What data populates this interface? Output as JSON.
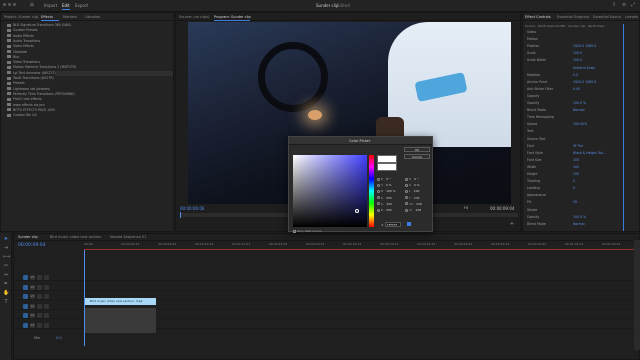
{
  "app": {
    "home_icon": "home-icon",
    "nav": [
      "Import",
      "Edit",
      "Export"
    ],
    "active_nav": "Edit",
    "title": "Sunder clip",
    "subtitle": "Edited"
  },
  "project_panel": {
    "tabs": [
      "Project: Sunder clip",
      "Effects",
      "Markers",
      "Libraries"
    ],
    "items": [
      {
        "label": "NLR Signature Transitions 360 (NAS)"
      },
      {
        "label": "Custom Presets"
      },
      {
        "label": "Audio Effects"
      },
      {
        "label": "Audio Transitions"
      },
      {
        "label": "Video Effects"
      },
      {
        "label": "Obsolete"
      },
      {
        "label": "Blur"
      },
      {
        "label": "Video Transitions"
      },
      {
        "label": "Motion Machine Transitions 2 (MMT2TR)"
      },
      {
        "label": "Lyt Text Animator (AELT2T)"
      },
      {
        "label": "TwoD Transitions (AG2TR)"
      },
      {
        "label": "Presets"
      },
      {
        "label": "Lightroom lab (presets)"
      },
      {
        "label": "Perfectly Time Transitions (PRTSUMNK)"
      },
      {
        "label": "ProVC text effects"
      },
      {
        "label": "www effects via pro"
      },
      {
        "label": "BITTS EFFECTS PACK 1000"
      },
      {
        "label": "Custom Bin LD"
      }
    ]
  },
  "program_monitor": {
    "tabs": [
      "Source: (no clips)",
      "Program: Sunder clip"
    ],
    "timecode_left": "00:00:06:06",
    "fit_label": "Fit",
    "timecode_right": "00:00:09:04"
  },
  "effect_controls": {
    "tabs": [
      "Effect Controls",
      "Essential Graphics",
      "Essential Sound",
      "Lumetri"
    ],
    "source_label": "Source · Nerfz Kaan Nrufflx · Sunder clip · Nerfz Kaan",
    "rows": [
      {
        "label": "Video",
        "value": ""
      },
      {
        "label": "Motion",
        "value": ""
      },
      {
        "label": "Position",
        "value": "1920.0   1080.0"
      },
      {
        "label": "Scale",
        "value": "100.0"
      },
      {
        "label": "Scale Width",
        "value": "100.0"
      },
      {
        "label": "",
        "value": "Uniform Scale"
      },
      {
        "label": "Rotation",
        "value": "0.0"
      },
      {
        "label": "Anchor Point",
        "value": "1920.0   1080.0"
      },
      {
        "label": "Anti-flicker Filter",
        "value": "0.00"
      },
      {
        "label": "Opacity",
        "value": ""
      },
      {
        "label": "Opacity",
        "value": "100.0 %"
      },
      {
        "label": "Blend Mode",
        "value": "Normal"
      },
      {
        "label": "Time Remapping",
        "value": ""
      },
      {
        "label": "Speed",
        "value": "100.00%"
      },
      {
        "label": "Text",
        "value": ""
      },
      {
        "label": "Source Text",
        "value": ""
      },
      {
        "label": "Font",
        "value": "SF Pro"
      },
      {
        "label": "Font Style",
        "value": "Black & Height Gol..."
      },
      {
        "label": "Font Size",
        "value": "100"
      },
      {
        "label": "Width",
        "value": "100"
      },
      {
        "label": "Height",
        "value": "100"
      },
      {
        "label": "Tracking",
        "value": "0"
      },
      {
        "label": "Leading",
        "value": "0"
      },
      {
        "label": "Appearance",
        "value": ""
      },
      {
        "label": "Fill",
        "value": "Fill"
      },
      {
        "label": "Stroke",
        "value": ""
      },
      {
        "label": "Opacity",
        "value": "100.0 %"
      },
      {
        "label": "Blend Mode",
        "value": "Normal"
      }
    ]
  },
  "color_picker": {
    "title": "Color Picker",
    "ok_label": "OK",
    "cancel_label": "Cancel",
    "hsb": [
      {
        "key": "H",
        "value": "0 °"
      },
      {
        "key": "S",
        "value": "0 %"
      },
      {
        "key": "B",
        "value": "100 %"
      },
      {
        "key": "R",
        "value": "255"
      },
      {
        "key": "G",
        "value": "255"
      },
      {
        "key": "B",
        "value": "255"
      }
    ],
    "hsl": [
      {
        "key": "H",
        "value": "0 °"
      },
      {
        "key": "S",
        "value": "0 %"
      },
      {
        "key": "L",
        "value": "100"
      },
      {
        "key": "Y",
        "value": "235"
      },
      {
        "key": "Cb",
        "value": "128"
      },
      {
        "key": "Cr",
        "value": "128"
      }
    ],
    "hex_label": "#",
    "hex_value": "FFFFFF",
    "web_only_label": "Only Web Colors",
    "new_color": "#ffffff",
    "current_color": "#ffffff",
    "field_hue": "#4040ff"
  },
  "timeline": {
    "tabs": [
      "Sunder clip",
      "Bird music video new section",
      "Nested Sequence 01"
    ],
    "timecode": "00:00:09:04",
    "ruler": [
      "00:00",
      "00:00:04:23",
      "00:00:09:23",
      "00:00:14:23",
      "00:00:19:23",
      "00:00:24:23",
      "00:00:29:23",
      "00:00:34:23",
      "00:00:39:23",
      "00:00:44:23",
      "00:00:49:23",
      "00:00:54:23",
      "00:00:59:22",
      "00:01:04:22",
      "00:01:09:22"
    ],
    "video_tracks": [
      "V3",
      "V2",
      "V1"
    ],
    "audio_tracks": [
      "A1",
      "A2",
      "A3"
    ],
    "mix_label": "Mix",
    "mix_value": "0.0",
    "clip_label": "Bird music video new section .mp4",
    "clip_color": "#a9d8f6"
  }
}
